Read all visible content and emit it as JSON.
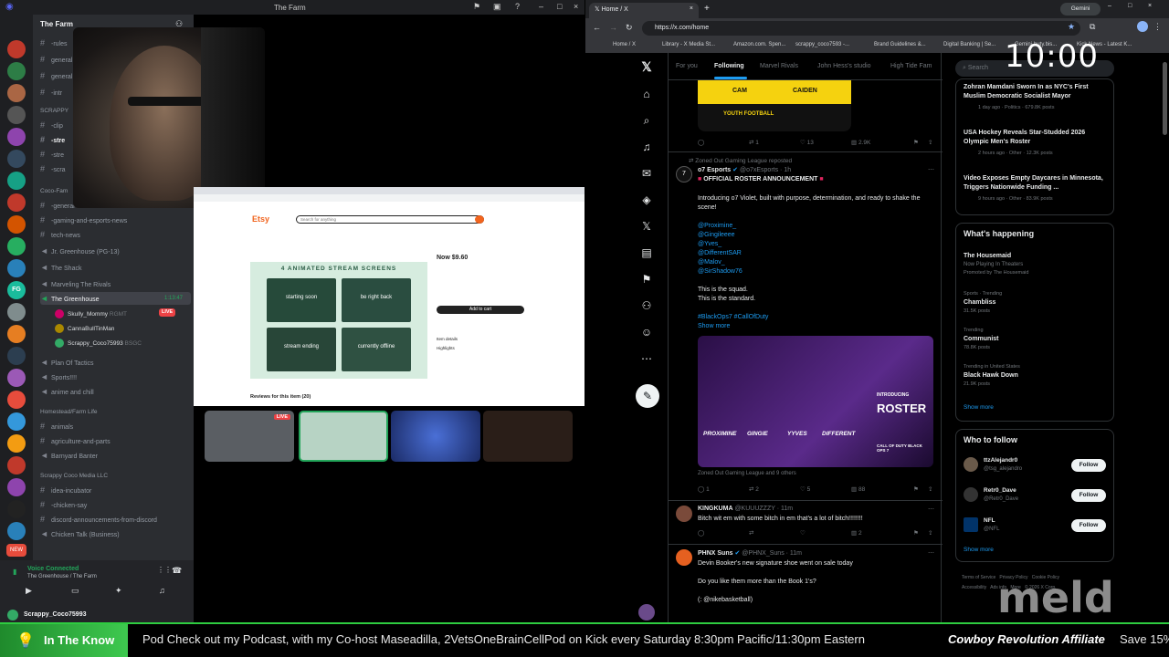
{
  "discord": {
    "window_title": "The Farm",
    "server_name": "The Farm",
    "channels_top": [
      "-rules",
      "general",
      "-intr"
    ],
    "category_scrappy": "SCRAPPY",
    "channels_scrappy": [
      "-clip",
      "-stre",
      "-stre",
      "-scra"
    ],
    "category_coco": "Coco-Fam",
    "channels_coco": [
      "-general",
      "-gaming-and-esports-news",
      "tech-news",
      "Jr. Greenhouse (PG-13)",
      "The Shack",
      "Marveling The Rivals",
      "The Greenhouse"
    ],
    "greenhouse_timer": "1:13:47",
    "voice_users": [
      {
        "name": "Skully_Mommy",
        "tag": "RGMT"
      },
      {
        "name": "CannaBullTinMan",
        "tag": ""
      },
      {
        "name": "Scrappy_Coco75993",
        "tag": "BSGC",
        "badge": "LIVE"
      }
    ],
    "live_badge": "LIVE",
    "channels_after": [
      "Plan Of Tactics",
      "Sports!!!!",
      "anime and chill"
    ],
    "category_homestead": "Homestead/Farm Life",
    "channels_homestead": [
      "animals",
      "agriculture-and-parts",
      "Barnyard Banter"
    ],
    "category_media": "Scrappy Coco Media LLC",
    "channels_media": [
      "idea-incubator",
      "-chicken-say",
      "discord-announcements-from-discord",
      "Chicken Talk (Business)"
    ],
    "voice_connected": "Voice Connected",
    "voice_location": "The Greenhouse / The Farm",
    "self_user": "Scrappy_Coco75993",
    "server_new_badge": "NEW"
  },
  "etsy": {
    "logo": "Etsy",
    "search_placeholder": "Search for anything",
    "product_title": "4 ANIMATED STREAM SCREENS",
    "screen_labels": [
      "starting soon",
      "be right back",
      "stream ending",
      "currently offline"
    ],
    "price": "Now $9.60",
    "add_to_cart": "Add to cart",
    "reviews": "Reviews for this item (20)",
    "item_details": "Item details",
    "highlights": "Highlights"
  },
  "tiles": {
    "live_badge": "LIVE"
  },
  "chrome": {
    "tabs": [
      {
        "title": "Home / X",
        "active": true
      }
    ],
    "new_tab": "+",
    "gemini": "Gemini",
    "url": "https://x.com/home",
    "bookmarks": [
      "Home / X",
      "Library - X Media St...",
      "Amazon.com. Spen...",
      "scrappy_coco7593 -...",
      "Brand Guidelines &...",
      "Digital Banking | Se...",
      "Gemini-buty.bis...",
      "Kick News - Latest K..."
    ]
  },
  "x": {
    "tabs": [
      "For you",
      "Following",
      "Marvel Rivals",
      "John Hess's studio",
      "High Tide Fam"
    ],
    "active_tab": "Following",
    "search_placeholder": "Search",
    "banner_names": [
      "CAM",
      "CAIDEN"
    ],
    "banner_caption": "YOUTH FOOTBALL",
    "post1_stats": {
      "replies": "",
      "reposts": "1",
      "likes": "13",
      "views": "2.9K"
    },
    "repost_label": "Zoned Out Gaming League reposted",
    "post2": {
      "name": "o7 Esports",
      "handle": "@o7xEsports · 1h",
      "headline": "OFFICIAL ROSTER ANNOUNCEMENT",
      "body": "Introducing o7 Violet, built with purpose, determination, and ready to shake the scene!",
      "mentions": [
        "@Proximine_",
        "@Gingileeee",
        "@Yves_",
        "@DifferentSAR",
        "@Malov_",
        "@SirShadow76"
      ],
      "line1": "This is the squad.",
      "line2": "This is the standard.",
      "hashtags": "#BlackOps7 #CallOfDuty",
      "show_more": "Show more",
      "image_names": [
        "PROXIMINE",
        "GINGIE",
        "YYVES",
        "DIFFERENT"
      ],
      "image_title": "ROSTER",
      "image_intro": "INTRODUCING",
      "image_game": "CALL OF DUTY BLACK OPS 7",
      "media_credit": "Zoned Out Gaming League and 9 others",
      "stats": {
        "replies": "1",
        "reposts": "2",
        "likes": "5",
        "views": "88"
      }
    },
    "post3": {
      "name": "KINGKUMA",
      "handle": "@KUUUZZZY · 11m",
      "body": "Bitch wit em with some bitch in em that's a lot of bitch!!!!!!!!",
      "stats": {
        "likes": "2"
      }
    },
    "post4": {
      "name": "PHNX Suns",
      "handle": "@PHNX_Suns · 11m",
      "body": "Devin Booker's new signature shoe went on sale today",
      "line2": "Do you like them more than the Book 1's?",
      "credit": "(: @nikebasketball)"
    },
    "news": [
      {
        "title": "Zohran Mamdani Sworn In as NYC's First Muslim Democratic Socialist Mayor",
        "meta": "1 day ago · Politics · 679.8K posts"
      },
      {
        "title": "USA Hockey Reveals Star-Studded 2026 Olympic Men's Roster",
        "meta": "2 hours ago · Other · 12.3K posts"
      },
      {
        "title": "Video Exposes Empty Daycares in Minnesota, Triggers Nationwide Funding ...",
        "meta": "9 hours ago · Other · 83.9K posts"
      }
    ],
    "whats_happening": "What's happening",
    "trends": [
      {
        "context": "",
        "title": "The Housemaid",
        "meta": "Now Playing In Theaters",
        "extra": "Promoted by The Housemaid"
      },
      {
        "context": "Sports · Trending",
        "title": "Chambliss",
        "meta": "31.5K posts"
      },
      {
        "context": "Trending",
        "title": "Communist",
        "meta": "78.8K posts"
      },
      {
        "context": "Trending in United States",
        "title": "Black Hawk Down",
        "meta": "21.9K posts"
      }
    ],
    "show_more": "Show more",
    "who_to_follow": "Who to follow",
    "follow_suggestions": [
      {
        "name": "ttzAlejandr0",
        "handle": "@tsg_alejandro"
      },
      {
        "name": "Retr0_Dave",
        "handle": "@Retr0_Dave"
      },
      {
        "name": "NFL",
        "handle": "@NFL"
      }
    ],
    "follow_label": "Follow",
    "footer_links": [
      "Terms of Service",
      "Privacy Policy",
      "Cookie Policy",
      "Accessibility",
      "Ads info",
      "More",
      "© 2026 X Corp."
    ]
  },
  "overlay": {
    "clock": "10:00",
    "corner_logo": "meld",
    "ticker_label": "In The Know",
    "ticker_text": "Pod  Check out my Podcast, with my Co-host Maseadilla, 2VetsOneBrainCellPod on Kick every Saturday 8:30pm Pacific/11:30pm Eastern",
    "ticker_affiliate": "Cowboy Revolution Affiliate",
    "ticker_tail": "Save 15%"
  },
  "colors": {
    "discord_bg": "#313338",
    "x_blue": "#1d9bf0",
    "ticker_green": "#2ecc40",
    "live_red": "#ed4245"
  }
}
